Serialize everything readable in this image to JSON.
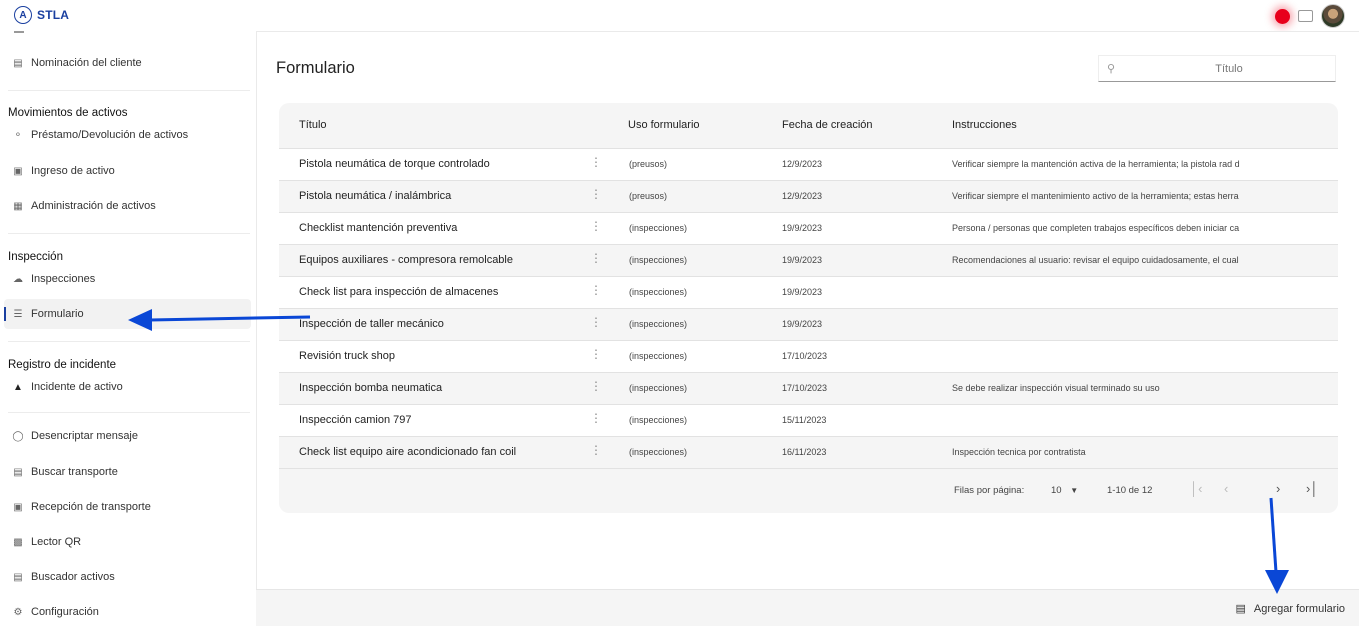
{
  "app": {
    "logo_letter": "A",
    "name": "STLA"
  },
  "sidebar": {
    "top_item": "Nominación del cliente",
    "sections": [
      {
        "heading": "Movimientos de activos",
        "items": [
          "Préstamo/Devolución de activos",
          "Ingreso de activo",
          "Administración de activos"
        ]
      },
      {
        "heading": "Inspección",
        "items": [
          "Inspecciones",
          "Formulario"
        ]
      },
      {
        "heading": "Registro de incidente",
        "items": [
          "Incidente de activo"
        ]
      }
    ],
    "tools": [
      "Desencriptar mensaje",
      "Buscar transporte",
      "Recepción de transporte",
      "Lector QR",
      "Buscador activos",
      "Configuración"
    ],
    "active_item": "Formulario"
  },
  "page": {
    "title": "Formulario",
    "search_placeholder": "Título"
  },
  "table": {
    "columns": [
      "Título",
      "Uso formulario",
      "Fecha de creación",
      "Instrucciones"
    ],
    "rows": [
      {
        "titulo": "Pistola neumática de torque controlado",
        "uso": "(preusos)",
        "fecha": "12/9/2023",
        "instrucciones": "Verificar siempre la mantención activa de la herramienta; la pistola rad d"
      },
      {
        "titulo": "Pistola neumática / inalámbrica",
        "uso": "(preusos)",
        "fecha": "12/9/2023",
        "instrucciones": "Verificar siempre el mantenimiento activo de la herramienta; estas herra"
      },
      {
        "titulo": "Checklist mantención preventiva",
        "uso": "(inspecciones)",
        "fecha": "19/9/2023",
        "instrucciones": "Persona / personas que completen trabajos específicos deben iniciar ca"
      },
      {
        "titulo": "Equipos auxiliares - compresora remolcable",
        "uso": "(inspecciones)",
        "fecha": "19/9/2023",
        "instrucciones": "Recomendaciones al usuario: revisar el equipo cuidadosamente, el cual"
      },
      {
        "titulo": "Check list para inspección de almacenes",
        "uso": "(inspecciones)",
        "fecha": "19/9/2023",
        "instrucciones": ""
      },
      {
        "titulo": "Inspección de taller mecánico",
        "uso": "(inspecciones)",
        "fecha": "19/9/2023",
        "instrucciones": ""
      },
      {
        "titulo": "Revisión truck shop",
        "uso": "(inspecciones)",
        "fecha": "17/10/2023",
        "instrucciones": ""
      },
      {
        "titulo": "Inspección bomba neumatica",
        "uso": "(inspecciones)",
        "fecha": "17/10/2023",
        "instrucciones": "Se debe realizar inspección visual terminado su uso"
      },
      {
        "titulo": "Inspección camion 797",
        "uso": "(inspecciones)",
        "fecha": "15/11/2023",
        "instrucciones": ""
      },
      {
        "titulo": "Check list equipo aire acondicionado fan coil",
        "uso": "(inspecciones)",
        "fecha": "16/11/2023",
        "instrucciones": "Inspección tecnica por contratista"
      }
    ],
    "pagination": {
      "rows_label": "Filas por página:",
      "rows_value": "10",
      "range": "1-10 de 12"
    }
  },
  "footer": {
    "add_label": "Agregar formulario"
  },
  "colors": {
    "accent": "#1a3fa0",
    "annotation_arrow": "#0a47d6",
    "recording": "#e8001b"
  }
}
